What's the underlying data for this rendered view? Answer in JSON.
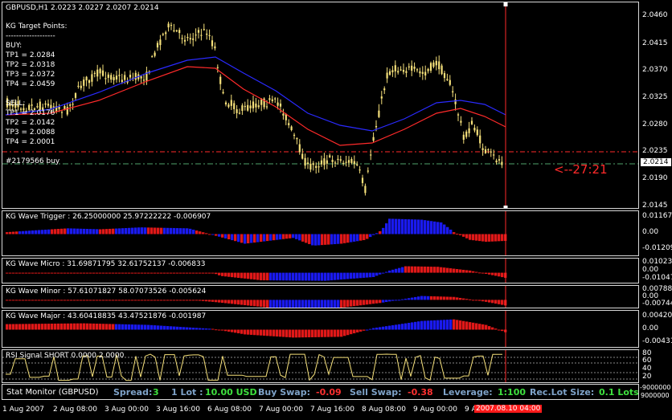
{
  "main": {
    "title": "GBPUSD,H1  2.0223 2.0227 2.0207 2.0214",
    "kg_header": "KG Target Points:",
    "kg_divider": "-------------------",
    "buy_label": "BUY:",
    "buy_tps": [
      "TP1 = 2.0284",
      "TP2 = 2.0318",
      "TP3 = 2.0372",
      "TP4 = 2.0459"
    ],
    "sell_label": "SELL:",
    "sell_tps": [
      "TP1 = 2.0176",
      "TP2 = 2.0142",
      "TP3 = 2.0088",
      "TP4 = 2.0001"
    ],
    "order_label": "#2179566 buy",
    "countdown": "<--27:21",
    "price_ticks": [
      "2.0460",
      "2.0415",
      "2.0370",
      "2.0325",
      "2.0280",
      "2.0235",
      "2.0190",
      "2.0145"
    ],
    "current_price": "2.0214",
    "colors": {
      "candle": "#f5e07a",
      "ma_fast": "#ff2a2a",
      "ma_slow": "#2a2aff",
      "level": "#ff2a2a",
      "order": "#4fa56b",
      "vline": "#ff2a2a",
      "countdown": "#ff2a2a"
    }
  },
  "indicators": [
    {
      "title": "KG Wave Trigger : 26.25000000 25.97222222 -0.006907",
      "ticks": [
        "0.01167",
        "0.00",
        "-0.01209"
      ]
    },
    {
      "title": "KG Wave Micro : 31.69871795 32.61752137 -0.006833",
      "ticks": [
        "0.01023",
        "0.00",
        "-0.01047"
      ]
    },
    {
      "title": "KG Wave Minor : 57.61071827 58.07073526 -0.005624",
      "ticks": [
        "0.00788",
        "0.00",
        "-0.00744"
      ]
    },
    {
      "title": "KG Wave Major : 43.60418835 43.47521876 -0.001987",
      "ticks": [
        "0.00420",
        "0.00",
        "-0.00431"
      ]
    },
    {
      "title": "RSI Signal SHORT 0.0000 2.0000",
      "ticks": [
        "80",
        "60",
        "40",
        "20"
      ]
    }
  ],
  "status": {
    "name": "Stat Monitor (GBPUSD)",
    "spread_label": "Spread:",
    "spread_value": "3",
    "lot_label": "1 Lot :",
    "lot_value": "10.00 USD",
    "buyswap_label": "Buy Swap:",
    "buyswap_value": "-0.09",
    "sellswap_label": "Sell Swap:",
    "sellswap_value": "-0.38",
    "leverage_label": "Leverage:",
    "leverage_value": "1:100",
    "reclot_label": "Rec.Lot Size:",
    "reclot_value": "0.1 Lots",
    "axis_top": "-9000000",
    "axis_bottom": "9000000"
  },
  "time_axis": [
    "1 Aug 2007",
    "2 Aug 08:00",
    "3 Aug 00:00",
    "3 Aug 16:00",
    "6 Aug 08:00",
    "7 Aug 00:00",
    "7 Aug 16:00",
    "8 Aug 08:00",
    "9 Aug 00:00",
    "9 Aug 16:00"
  ],
  "time_cursor": "2007.08.10 04:00"
}
